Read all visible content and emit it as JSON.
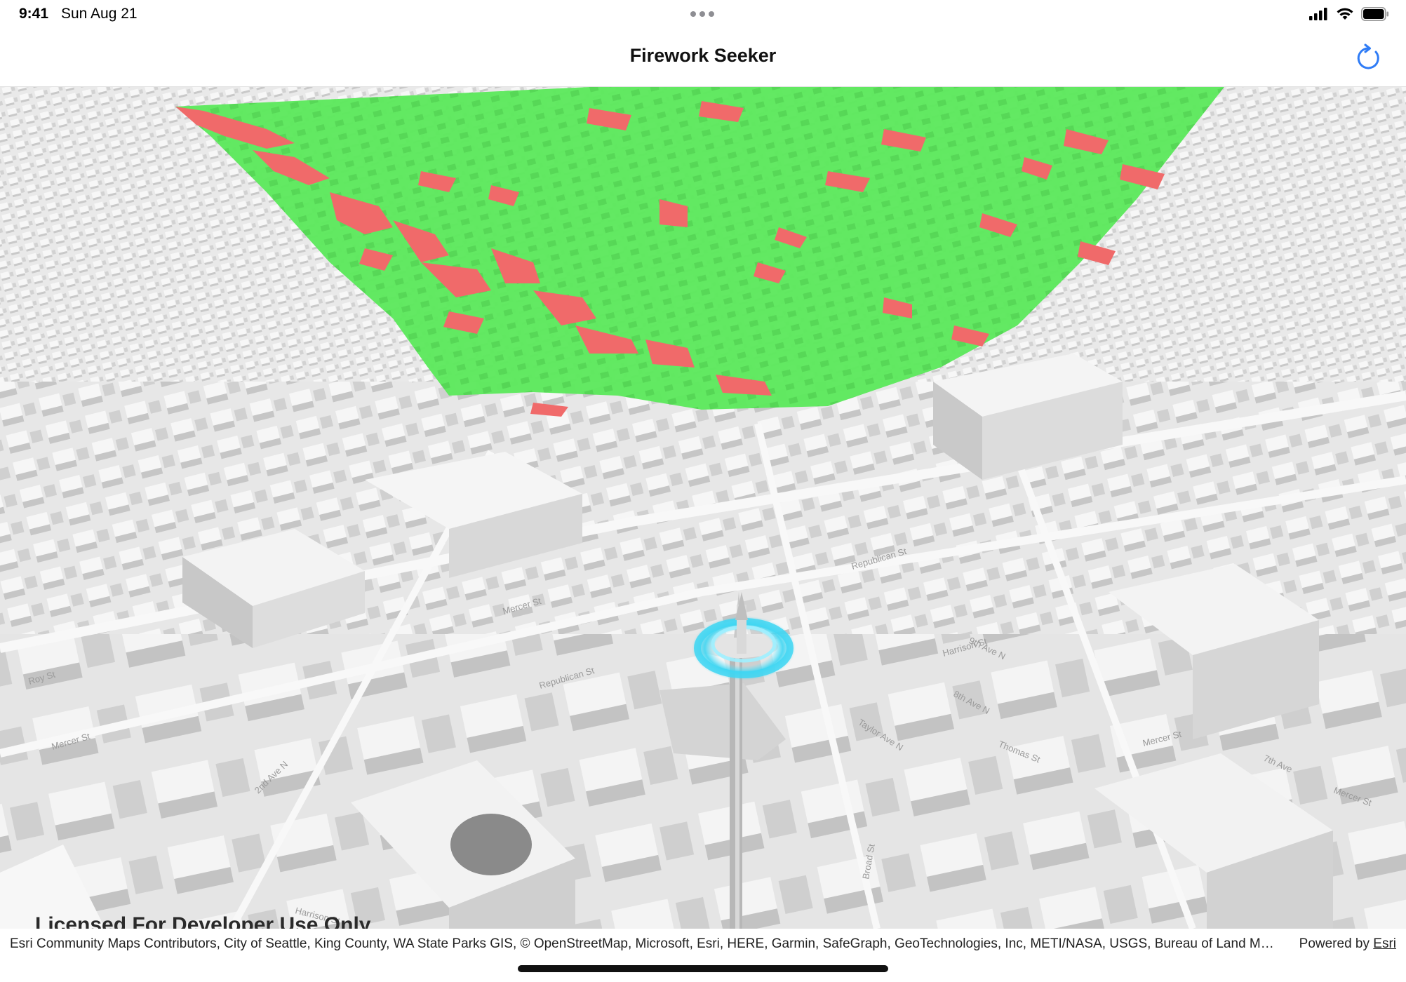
{
  "status_bar": {
    "time": "9:41",
    "date": "Sun Aug 21",
    "icons": [
      "cellular-signal-icon",
      "wifi-icon",
      "battery-icon"
    ]
  },
  "nav": {
    "title": "Firework Seeker",
    "refresh_icon": "arrow-clockwise-icon",
    "accent_color": "#2f7cf6"
  },
  "scene": {
    "visible_color": "#5de85d",
    "not_visible_color": "#f06a6a",
    "building_color": "#dcdcdc",
    "observer_ring_color": "#38d3ef",
    "street_labels": [
      "Mercer St",
      "Mercer St",
      "Roy St",
      "Republican St",
      "Republican St",
      "Harrison St",
      "Taylor Ave N",
      "8th Ave N",
      "9th Ave N",
      "7th Ave",
      "Thomas St",
      "Broad St",
      "2nd Ave N",
      "Harrison St",
      "Mercer St",
      "Mercer St"
    ]
  },
  "watermark": "Licensed For Developer Use Only",
  "attribution": {
    "text": "Esri Community Maps Contributors, City of Seattle, King County, WA State Parks GIS, © OpenStreetMap, Microsoft, Esri, HERE, Garmin, SafeGraph, GeoTechnologies, Inc, METI/NASA, USGS, Bureau of Land Management, EPA, NPS, US Census Bureau, USDA, USFWS",
    "powered_by_prefix": "Powered by",
    "powered_by_link": "Esri"
  }
}
